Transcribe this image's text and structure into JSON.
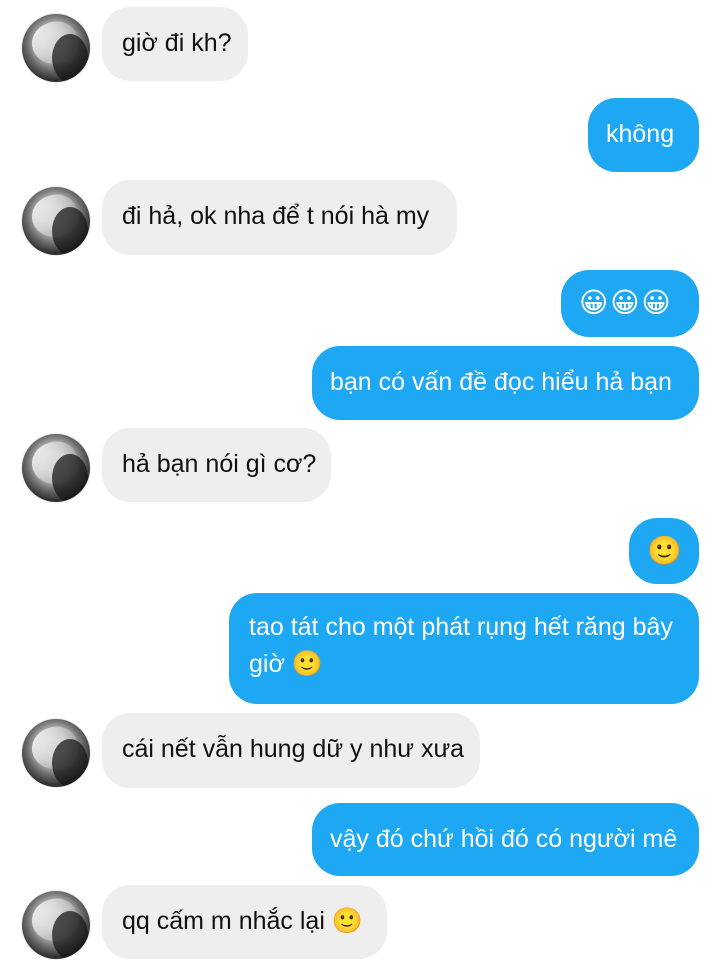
{
  "messages": {
    "m1": "giờ đi kh?",
    "m2": "không",
    "m3": "đi hả, ok nha để t nói hà my",
    "m4": "😀😀😀",
    "m5": "bạn có vấn đề đọc hiểu hả bạn",
    "m6": "hả bạn nói gì cơ?",
    "m7": "🙂",
    "m8": "tao tát cho một phát rụng hết răng bây giờ 🙂",
    "m9": "cái nết vẫn hung dữ y như xưa",
    "m10": "vậy đó chứ hồi đó có người mê",
    "m11": "qq cấm m nhắc lại 🙂"
  },
  "colors": {
    "incoming_bubble": "#eeeeef",
    "outgoing_bubble": "#1ea7f3"
  }
}
